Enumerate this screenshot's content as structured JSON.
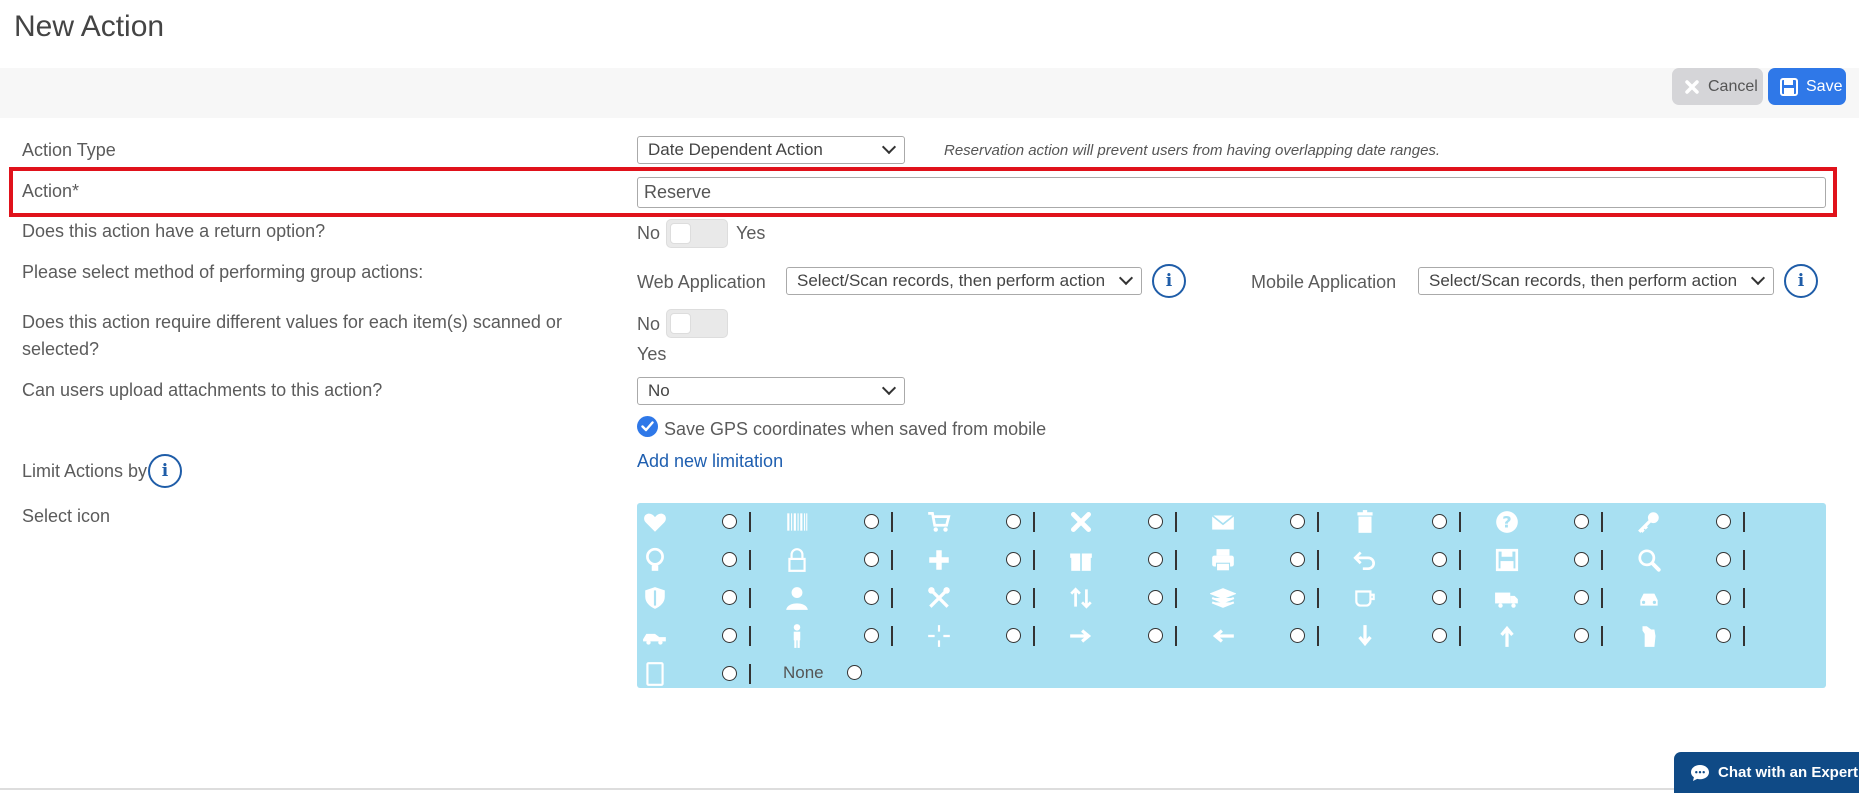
{
  "page": {
    "title": "New Action"
  },
  "toolbar": {
    "cancel_label": "Cancel",
    "save_label": "Save"
  },
  "form": {
    "action_type": {
      "label": "Action Type",
      "value": "Date Dependent Action",
      "note": "Reservation action will prevent users from having overlapping date ranges."
    },
    "action_name": {
      "label": "Action*",
      "value": "Reserve"
    },
    "return_option": {
      "label": "Does this action have a return option?",
      "no": "No",
      "yes": "Yes"
    },
    "group_method": {
      "label": "Please select method of performing group actions:",
      "web_label": "Web Application",
      "web_value": "Select/Scan records, then perform action",
      "mobile_label": "Mobile Application",
      "mobile_value": "Select/Scan records, then perform action"
    },
    "different_values": {
      "label_line1": "Does this action require different values for each item(s) scanned or",
      "label_line2": "selected?",
      "no": "No",
      "yes": "Yes"
    },
    "attachments": {
      "label": "Can users upload attachments to this action?",
      "value": "No"
    },
    "gps": {
      "label": "Save GPS coordinates when saved from mobile",
      "checked": true
    },
    "limit": {
      "label": "Limit Actions by",
      "link": "Add new limitation"
    },
    "icons": {
      "label": "Select icon",
      "none_label": "None",
      "items": [
        "heart-icon",
        "barcode-icon",
        "cart-icon",
        "close-icon",
        "envelope-icon",
        "trash-icon",
        "question-icon",
        "key-icon",
        "lightbulb-icon",
        "lock-icon",
        "plus-icon",
        "gift-icon",
        "printer-icon",
        "undo-icon",
        "save-icon",
        "search-icon",
        "shield-icon",
        "user-icon",
        "tools-icon",
        "sort-icon",
        "stack-icon",
        "coffee-icon",
        "truck-icon",
        "car-front-icon",
        "car-side-icon",
        "person-icon",
        "move-icon",
        "arrow-right-icon",
        "arrow-left-icon",
        "arrow-down-icon",
        "arrow-up-icon",
        "hand-icon",
        "tablet-icon"
      ]
    }
  },
  "chat": {
    "label": "Chat with an Expert"
  },
  "colors": {
    "accent": "#2f78e8",
    "highlight": "#e0121b",
    "icon_panel": "#a8e0f2",
    "chat": "#0f4a86"
  }
}
